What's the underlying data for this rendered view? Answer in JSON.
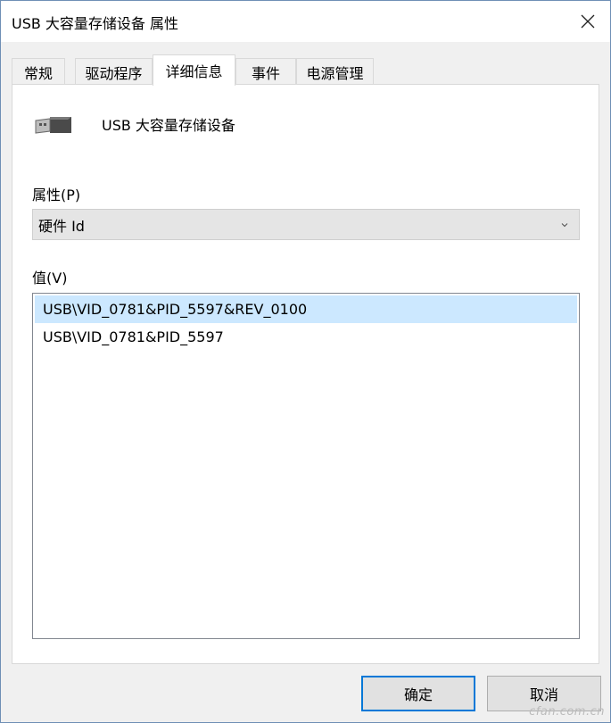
{
  "window": {
    "title": "USB 大容量存储设备 属性"
  },
  "tabs": [
    {
      "label": "常规"
    },
    {
      "label": "驱动程序"
    },
    {
      "label": "详细信息"
    },
    {
      "label": "事件"
    },
    {
      "label": "电源管理"
    }
  ],
  "active_tab": "详细信息",
  "device": {
    "name": "USB 大容量存储设备",
    "icon": "usb-plug-icon"
  },
  "property": {
    "label": "属性(P)",
    "selected_value": "硬件 Id"
  },
  "values": {
    "label": "值(V)",
    "items": [
      "USB\\VID_0781&PID_5597&REV_0100",
      "USB\\VID_0781&PID_5597"
    ]
  },
  "buttons": {
    "ok_label": "确定",
    "cancel_label": "取消"
  },
  "watermark": "cfan.com.cn",
  "colors": {
    "selection": "#cce8ff",
    "primary_border": "#0078d7"
  }
}
